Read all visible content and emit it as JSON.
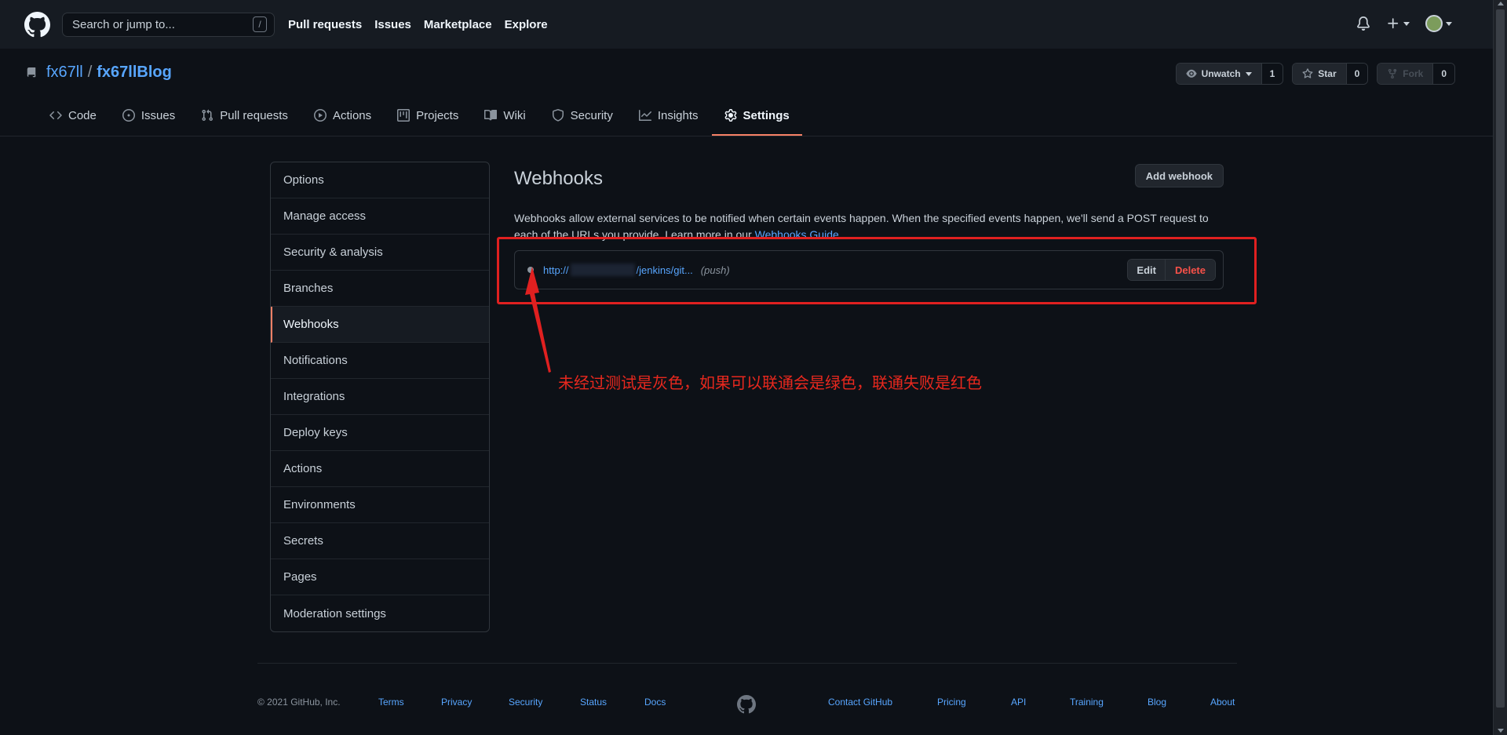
{
  "header": {
    "search_placeholder": "Search or jump to...",
    "search_shortcut": "/",
    "nav": [
      "Pull requests",
      "Issues",
      "Marketplace",
      "Explore"
    ]
  },
  "repo": {
    "owner": "fx67ll",
    "separator": "/",
    "name": "fx67llBlog",
    "unwatch_label": "Unwatch",
    "watch_count": "1",
    "star_label": "Star",
    "star_count": "0",
    "fork_label": "Fork",
    "fork_count": "0",
    "tabs": [
      {
        "label": "Code",
        "icon": "code-icon"
      },
      {
        "label": "Issues",
        "icon": "issue-icon"
      },
      {
        "label": "Pull requests",
        "icon": "pull-request-icon"
      },
      {
        "label": "Actions",
        "icon": "play-icon"
      },
      {
        "label": "Projects",
        "icon": "project-icon"
      },
      {
        "label": "Wiki",
        "icon": "book-icon"
      },
      {
        "label": "Security",
        "icon": "shield-icon"
      },
      {
        "label": "Insights",
        "icon": "graph-icon"
      },
      {
        "label": "Settings",
        "icon": "gear-icon",
        "active": true
      }
    ]
  },
  "sidebar": {
    "items": [
      "Options",
      "Manage access",
      "Security & analysis",
      "Branches",
      "Webhooks",
      "Notifications",
      "Integrations",
      "Deploy keys",
      "Actions",
      "Environments",
      "Secrets",
      "Pages",
      "Moderation settings"
    ],
    "active_index": 4
  },
  "main": {
    "title": "Webhooks",
    "add_button": "Add webhook",
    "description": "Webhooks allow external services to be notified when certain events happen. When the specified events happen, we'll send a POST request to each of the URLs you provide. Learn more in our ",
    "guide_link": "Webhooks Guide",
    "description_end": "."
  },
  "webhook": {
    "url_prefix": "http://",
    "url_suffix": "/jenkins/git...",
    "event": "(push)",
    "status": "untested",
    "status_color": "#8b949e",
    "edit_label": "Edit",
    "delete_label": "Delete"
  },
  "annotation": {
    "text": "未经过测试是灰色，如果可以联通会是绿色，联通失败是红色",
    "color": "#e02020"
  },
  "footer": {
    "copyright": "© 2021 GitHub, Inc.",
    "left_links": [
      "Terms",
      "Privacy",
      "Security",
      "Status",
      "Docs"
    ],
    "right_links": [
      "Contact GitHub",
      "Pricing",
      "API",
      "Training",
      "Blog",
      "About"
    ]
  },
  "colors": {
    "background": "#0d1117",
    "header": "#161b22",
    "link": "#58a6ff",
    "active_tab_underline": "#f78166",
    "danger": "#f85149"
  }
}
